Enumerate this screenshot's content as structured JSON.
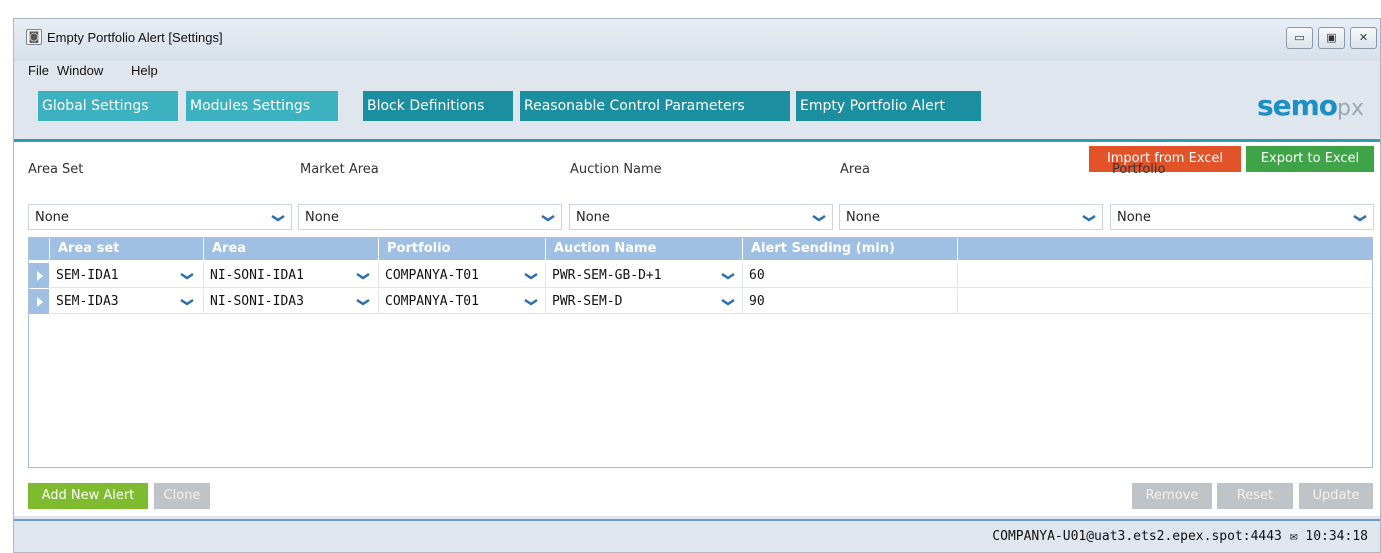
{
  "window": {
    "title": "Empty Portfolio Alert [Settings]",
    "controls": {
      "minimize": "▭",
      "maximize": "▣",
      "close": "✕"
    }
  },
  "menu": [
    "File",
    "Window",
    "Help"
  ],
  "tabs": [
    {
      "label": "Global Settings",
      "style": "light"
    },
    {
      "label": "Modules Settings",
      "style": "light"
    },
    {
      "label": "Block Definitions",
      "style": "dark"
    },
    {
      "label": "Reasonable Control Parameters",
      "style": "dark"
    },
    {
      "label": "Empty Portfolio Alert",
      "style": "dark"
    }
  ],
  "logo": {
    "main": "semo",
    "suffix": "px"
  },
  "actions": {
    "import": "Import from Excel",
    "export": "Export to Excel"
  },
  "filters": [
    {
      "label": "Area Set",
      "value": "None"
    },
    {
      "label": "Market Area",
      "value": "None"
    },
    {
      "label": "Auction Name",
      "value": "None"
    },
    {
      "label": "Area",
      "value": "None"
    },
    {
      "label": "Portfolio",
      "value": "None"
    }
  ],
  "grid": {
    "columns": [
      "Area set",
      "Area",
      "Portfolio",
      "Auction Name",
      "Alert Sending (min)"
    ],
    "rows": [
      [
        "SEM-IDA1",
        "NI-SONI-IDA1",
        "COMPANYA-T01",
        "PWR-SEM-GB-D+1",
        "60"
      ],
      [
        "SEM-IDA3",
        "NI-SONI-IDA3",
        "COMPANYA-T01",
        "PWR-SEM-D",
        "90"
      ]
    ]
  },
  "footer_buttons": {
    "add": "Add New Alert",
    "clone": "Clone",
    "remove": "Remove",
    "reset": "Reset",
    "update": "Update"
  },
  "status": {
    "connection": "COMPANYA-U01@uat3.ets2.epex.spot:4443",
    "time": "10:34:18"
  },
  "colors": {
    "accent": "#1b8e9f",
    "tab_light": "#3cb1c0",
    "import": "#e2532a",
    "export": "#3fa448",
    "add": "#7fbb2e"
  }
}
